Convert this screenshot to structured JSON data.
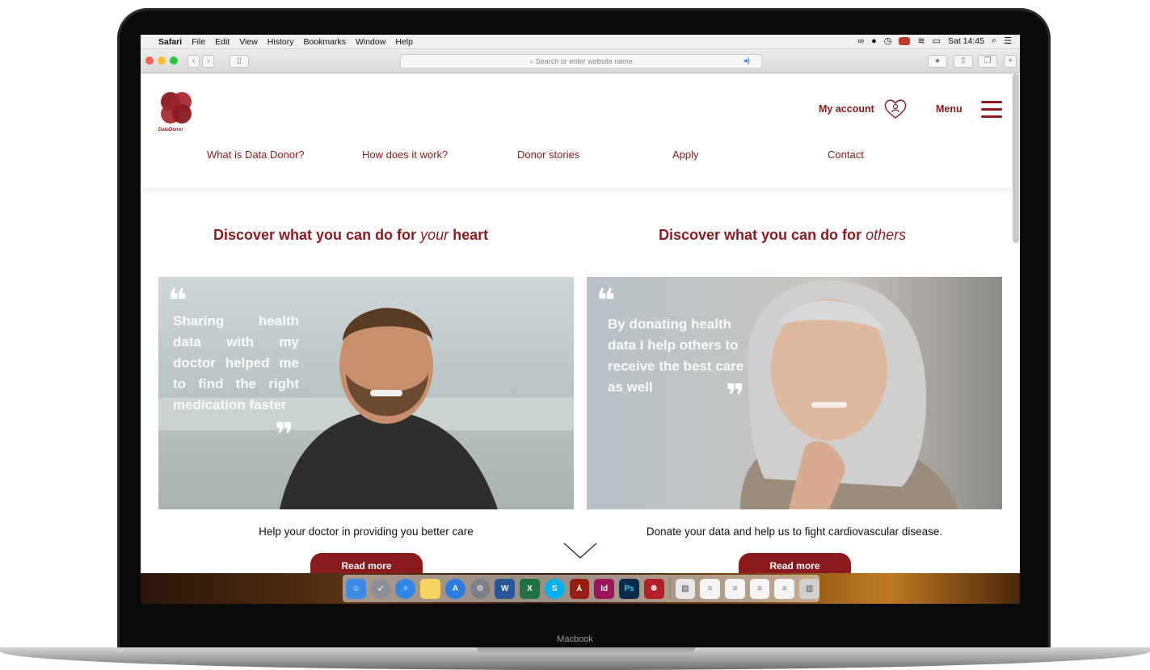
{
  "device": {
    "label": "Macbook"
  },
  "menubar": {
    "app": "Safari",
    "items": [
      "File",
      "Edit",
      "View",
      "History",
      "Bookmarks",
      "Window",
      "Help"
    ],
    "clock": "Sat 14:45"
  },
  "browser": {
    "search_placeholder": "Search or enter website name"
  },
  "site": {
    "logo_text": "DataDonor",
    "account_label": "My account",
    "menu_label": "Menu",
    "nav": [
      "What is Data Donor?",
      "How does it work?",
      "Donor stories",
      "Apply",
      "Contact"
    ],
    "accent_color": "#8b1a1f"
  },
  "cards": [
    {
      "heading_prefix": "Discover what you can do for ",
      "heading_em": "your",
      "heading_suffix": " heart",
      "quote": "Sharing health data with my doctor helped me to find the right medication faster",
      "caption": "Help your doctor in providing you better care",
      "button": "Read more"
    },
    {
      "heading_prefix": "Discover what you can do for ",
      "heading_em": "others",
      "heading_suffix": "",
      "quote": "By donating health data I help others to receive the best care as well",
      "caption": "Donate your data and help us to fight cardiovascular disease.",
      "button": "Read more"
    }
  ],
  "dock": {
    "apps": [
      "finder-icon",
      "launchpad-icon",
      "safari-icon",
      "notes-icon",
      "app-store-icon",
      "system-preferences-icon",
      "word-icon",
      "excel-icon",
      "skype-icon",
      "acrobat-icon",
      "indesign-icon",
      "photoshop-icon",
      "mendeley-icon",
      "preview-icon",
      "document-icon",
      "document-icon",
      "document-icon",
      "document-icon",
      "trash-icon"
    ],
    "labels": {
      "word": "W",
      "excel": "X",
      "skype": "S",
      "indesign": "Id",
      "photoshop": "Ps"
    }
  }
}
